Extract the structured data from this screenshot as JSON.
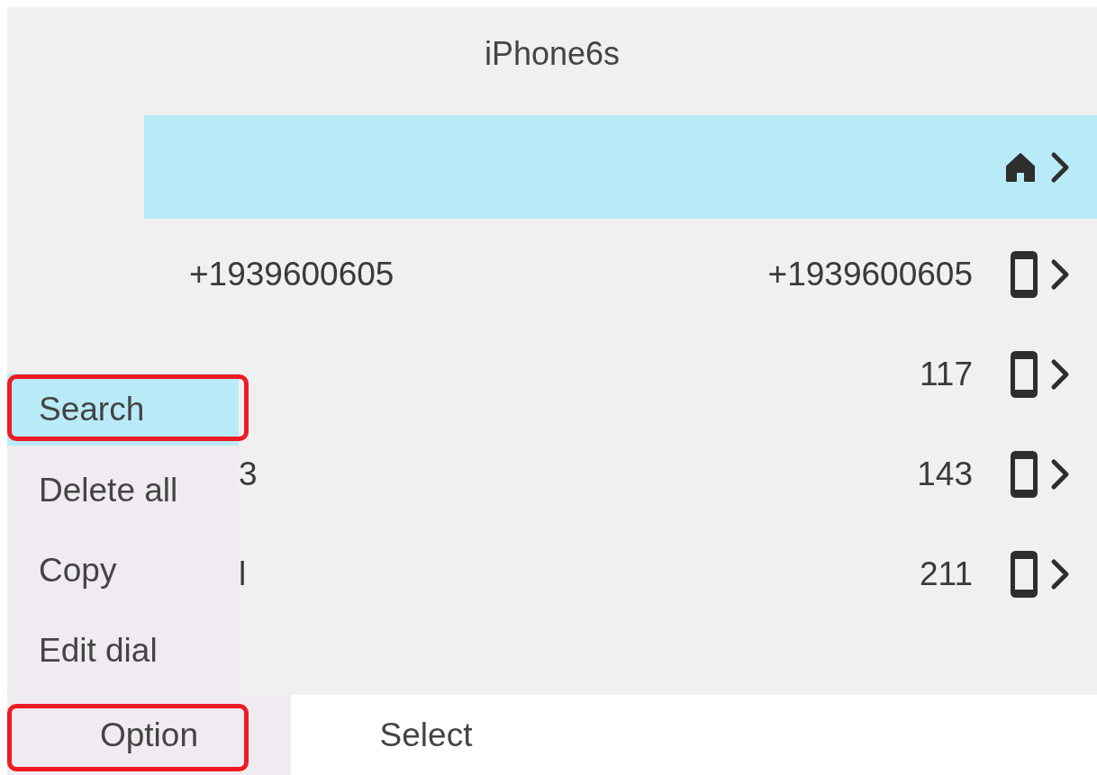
{
  "header": {
    "title": "iPhone6s"
  },
  "rows": [
    {
      "name": "",
      "number": "",
      "kind": "home",
      "selected": true,
      "clipped": false
    },
    {
      "name": "+1939600605",
      "number": "+1939600605",
      "kind": "mobile",
      "selected": false,
      "clipped": false
    },
    {
      "name": "",
      "number": "117",
      "kind": "mobile",
      "selected": false,
      "clipped": true
    },
    {
      "name": "3",
      "number": "143",
      "kind": "mobile",
      "selected": false,
      "clipped": true
    },
    {
      "name": "l",
      "number": "211",
      "kind": "mobile",
      "selected": false,
      "clipped": true
    }
  ],
  "menu": {
    "items": [
      {
        "label": "Search",
        "selected": true,
        "highlighted": true
      },
      {
        "label": "Delete all",
        "selected": false,
        "highlighted": false
      },
      {
        "label": "Copy",
        "selected": false,
        "highlighted": false
      },
      {
        "label": "Edit dial",
        "selected": false,
        "highlighted": false
      }
    ]
  },
  "softkeys": [
    {
      "label": "Option",
      "active": true,
      "highlighted": true
    },
    {
      "label": "Select",
      "active": false,
      "highlighted": false
    }
  ]
}
